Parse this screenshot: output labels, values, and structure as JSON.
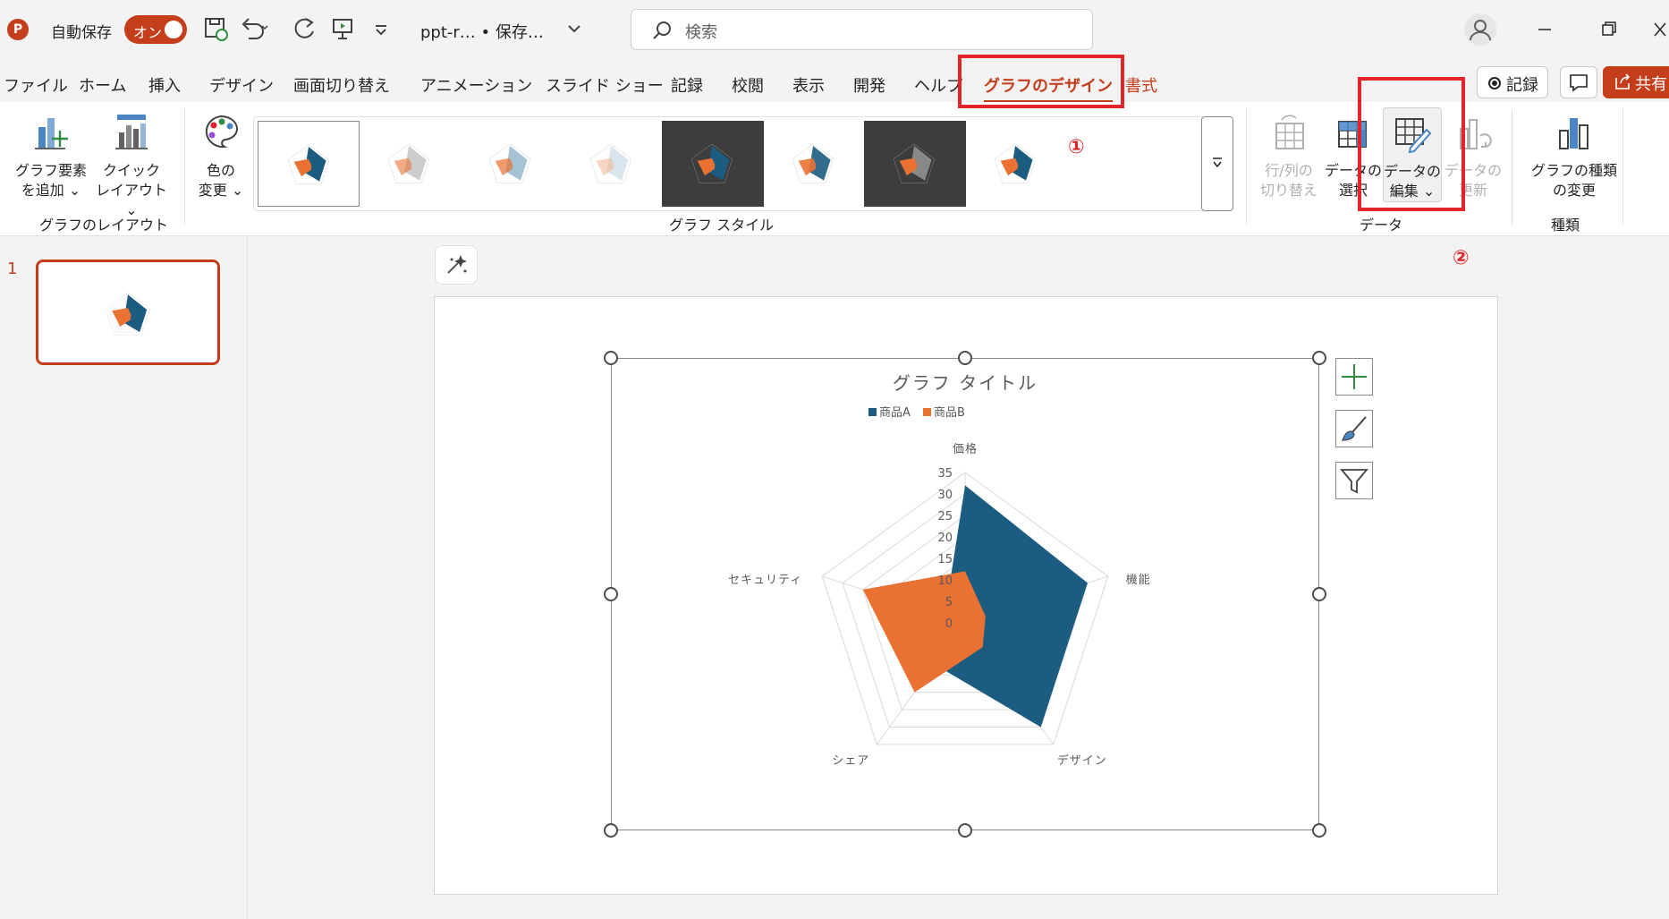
{
  "titlebar": {
    "app_icon": "P",
    "autosave_label": "自動保存",
    "toggle_label": "オン",
    "doc_title": "ppt-r… • 保存…",
    "search_placeholder": "検索"
  },
  "tabs": [
    "ファイル",
    "ホーム",
    "挿入",
    "デザイン",
    "画面切り替え",
    "アニメーション",
    "スライド ショー",
    "記録",
    "校閲",
    "表示",
    "開発",
    "ヘルプ",
    "グラフのデザイン",
    "書式"
  ],
  "active_tab": "グラフのデザイン",
  "header_buttons": {
    "record": "記録",
    "share": "共有"
  },
  "ribbon": {
    "add_element_1": "グラフ要素",
    "add_element_2": "を追加",
    "quick_layout_1": "クイック",
    "quick_layout_2": "レイアウト",
    "color_change_1": "色の",
    "color_change_2": "変更",
    "switch_rowcol_1": "行/列の",
    "switch_rowcol_2": "切り替え",
    "select_data_1": "データの",
    "select_data_2": "選択",
    "edit_data_1": "データの",
    "edit_data_2": "編集",
    "refresh_data_1": "データの",
    "refresh_data_2": "更新",
    "change_type_1": "グラフの種類",
    "change_type_2": "の変更",
    "group_layout": "グラフのレイアウト",
    "group_style": "グラフ スタイル",
    "group_data": "データ",
    "group_type": "種類"
  },
  "annotations": {
    "one": "①",
    "two": "②"
  },
  "slide_panel": {
    "number": "1"
  },
  "colors": {
    "accent": "#c43e1c",
    "seriesA": "#1b5c80",
    "seriesB": "#e97132",
    "annotation": "#e3242b"
  },
  "chart_data": {
    "type": "radar",
    "title": "グラフ タイトル",
    "categories": [
      "価格",
      "機能",
      "デザイン",
      "シェア",
      "セキュリティ"
    ],
    "series": [
      {
        "name": "商品A",
        "values": [
          32,
          30,
          30,
          12,
          5
        ]
      },
      {
        "name": "商品B",
        "values": [
          12,
          5,
          7,
          20,
          25
        ]
      }
    ],
    "rlim": [
      0,
      35
    ],
    "ticks": [
      "0",
      "5",
      "10",
      "15",
      "20",
      "25",
      "30",
      "35"
    ],
    "legend": "top"
  }
}
